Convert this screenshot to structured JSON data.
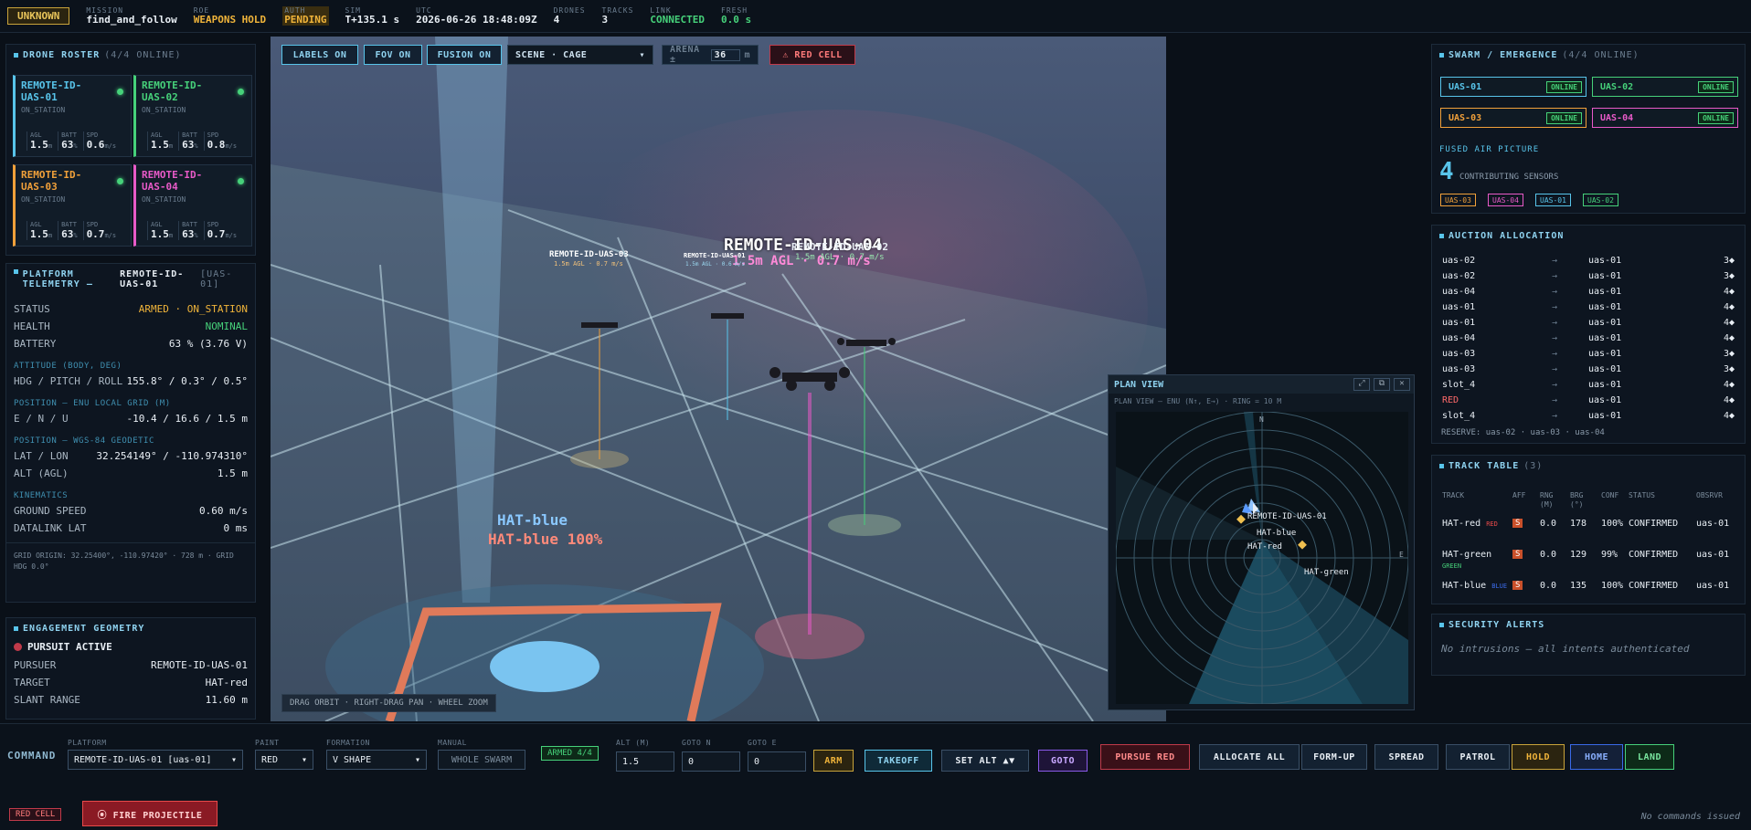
{
  "topbar": {
    "status": "UNKNOWN",
    "items": [
      {
        "k": "MISSION",
        "v": "find_and_follow"
      },
      {
        "k": "ROE",
        "v": "WEAPONS HOLD"
      },
      {
        "k": "AUTH",
        "v": "PENDING"
      },
      {
        "k": "SIM",
        "v": "T+135.1 s"
      },
      {
        "k": "UTC",
        "v": "2026-06-26 18:48:09Z"
      },
      {
        "k": "DRONES",
        "v": "4"
      },
      {
        "k": "TRACKS",
        "v": "3"
      },
      {
        "k": "LINK",
        "v": "CONNECTED"
      },
      {
        "k": "FRESH",
        "v": "0.0 s"
      }
    ]
  },
  "roster": {
    "title": "DRONE ROSTER",
    "sub": "(4/4 ONLINE)",
    "drones": [
      {
        "name": "REMOTE-ID-UAS-01",
        "state": "ON_STATION",
        "agl": "1.5",
        "batt": "63",
        "spd": "0.6",
        "color": "#58c4ea"
      },
      {
        "name": "REMOTE-ID-UAS-02",
        "state": "ON_STATION",
        "agl": "1.5",
        "batt": "63",
        "spd": "0.8",
        "color": "#46d17a"
      },
      {
        "name": "REMOTE-ID-UAS-03",
        "state": "ON_STATION",
        "agl": "1.5",
        "batt": "63",
        "spd": "0.7",
        "color": "#f0a03a"
      },
      {
        "name": "REMOTE-ID-UAS-04",
        "state": "ON_STATION",
        "agl": "1.5",
        "batt": "63",
        "spd": "0.7",
        "color": "#e85ac8"
      }
    ],
    "labels": {
      "agl": "AGL",
      "batt": "BATT",
      "spd": "SPD",
      "m": "m",
      "pct": "%",
      "ms": "m/s"
    }
  },
  "telemetry": {
    "title": "PLATFORM TELEMETRY —",
    "platform": "REMOTE-ID-UAS-01",
    "platform_id": "[UAS-01]",
    "status_k": "STATUS",
    "status_v": "ARMED · ON_STATION",
    "health_k": "HEALTH",
    "health_v": "NOMINAL",
    "battery_k": "BATTERY",
    "battery_v": "63 % (3.76 V)",
    "att_sec": "ATTITUDE (BODY, DEG)",
    "att_k": "HDG / PITCH / ROLL",
    "att_v": "155.8° / 0.3° / 0.5°",
    "pos_sec": "POSITION — ENU LOCAL GRID (M)",
    "enu_k": "E / N / U",
    "enu_v": "-10.4 / 16.6 / 1.5 m",
    "wgs_sec": "POSITION — WGS-84 GEODETIC",
    "ll_k": "LAT / LON",
    "ll_v": "32.254149° / -110.974310°",
    "alt_k": "ALT (AGL)",
    "alt_v": "1.5 m",
    "kin_sec": "KINEMATICS",
    "gs_k": "GROUND SPEED",
    "gs_v": "0.60 m/s",
    "dl_k": "DATALINK LAT",
    "dl_v": "0 ms",
    "grid": "GRID ORIGIN: 32.25400°, -110.97420° · 728 m · GRID HDG 0.0°"
  },
  "engagement": {
    "title": "ENGAGEMENT GEOMETRY",
    "state": "PURSUIT ACTIVE",
    "pursuer_k": "PURSUER",
    "pursuer_v": "REMOTE-ID-UAS-01",
    "target_k": "TARGET",
    "target_v": "HAT-red",
    "slant_k": "SLANT RANGE",
    "slant_v": "11.60 m"
  },
  "toolbar": {
    "labels": "LABELS ON",
    "fov": "FOV ON",
    "fusion": "FUSION ON",
    "scene": "SCENE · CAGE",
    "arena_k": "ARENA ±",
    "arena_v": "36",
    "arena_u": "m",
    "redcell": "⚠ RED CELL"
  },
  "scene": {
    "main_label": "REMOTE-ID-UAS-04",
    "main_sub": "1.5m AGL · 0.7 m/s",
    "uas02": "REMOTE-ID-UAS-02",
    "uas02_sub": "1.5m AGL · 0.7 m/s",
    "uas03": "REMOTE-ID-UAS-03",
    "uas03_sub": "1.5m AGL · 0.7 m/s",
    "uas01": "REMOTE-ID-UAS-01",
    "uas01_sub": "1.5m AGL · 0.6 m/s",
    "hat_blue": "HAT-blue",
    "hat_blue_conf": "HAT-blue 100%",
    "hint": "DRAG ORBIT · RIGHT-DRAG PAN · WHEEL ZOOM"
  },
  "plan": {
    "title": "PLAN VIEW",
    "sub": "PLAN VIEW — ENU (N↑, E→) · RING = 10 M",
    "n": "N",
    "e": "E",
    "lbl_uas": "REMOTE-ID-UAS-01",
    "lbl_hatblue": "HAT-blue",
    "lbl_hatred": "HAT-red",
    "lbl_hatgreen": "HAT-green"
  },
  "swarm": {
    "title": "SWARM / EMERGENCE",
    "sub": "(4/4 ONLINE)",
    "units": [
      {
        "name": "UAS-01",
        "status": "ONLINE",
        "color": "#58c4ea"
      },
      {
        "name": "UAS-02",
        "status": "ONLINE",
        "color": "#46d17a"
      },
      {
        "name": "UAS-03",
        "status": "ONLINE",
        "color": "#f0a03a"
      },
      {
        "name": "UAS-04",
        "status": "ONLINE",
        "color": "#e85ac8"
      }
    ],
    "fused_title": "FUSED AIR PICTURE",
    "count": "4",
    "count_label": "CONTRIBUTING SENSORS",
    "chips": [
      {
        "name": "UAS-03",
        "color": "#f0a03a"
      },
      {
        "name": "UAS-04",
        "color": "#e85ac8"
      },
      {
        "name": "UAS-01",
        "color": "#58c4ea"
      },
      {
        "name": "UAS-02",
        "color": "#46d17a"
      }
    ]
  },
  "auction": {
    "title": "AUCTION ALLOCATION",
    "rows": [
      {
        "a": "uas-02",
        "b": "uas-01",
        "c": "3◆"
      },
      {
        "a": "uas-02",
        "b": "uas-01",
        "c": "3◆"
      },
      {
        "a": "uas-04",
        "b": "uas-01",
        "c": "4◆"
      },
      {
        "a": "uas-01",
        "b": "uas-01",
        "c": "4◆"
      },
      {
        "a": "uas-01",
        "b": "uas-01",
        "c": "4◆"
      },
      {
        "a": "uas-04",
        "b": "uas-01",
        "c": "4◆"
      },
      {
        "a": "uas-03",
        "b": "uas-01",
        "c": "3◆"
      },
      {
        "a": "uas-03",
        "b": "uas-01",
        "c": "3◆"
      },
      {
        "a": "slot_4",
        "b": "uas-01",
        "c": "4◆"
      },
      {
        "a": "RED",
        "b": "uas-01",
        "c": "4◆"
      },
      {
        "a": "slot_4",
        "b": "uas-01",
        "c": "4◆"
      }
    ],
    "arrow": "→",
    "reserve": "RESERVE: uas-02 · uas-03 · uas-04"
  },
  "tracks": {
    "title": "TRACK TABLE",
    "sub": "(3)",
    "headers": [
      "TRACK",
      "AFF",
      "RNG (M)",
      "BRG (°)",
      "CONF",
      "STATUS",
      "OBSRVR"
    ],
    "rows": [
      {
        "track": "HAT-red",
        "tag": "RED",
        "tagcolor": "#e84a4a",
        "aff": "S",
        "rng": "0.0",
        "brg": "178",
        "conf": "100%",
        "status": "CONFIRMED",
        "obs": "uas-01"
      },
      {
        "track": "HAT-green",
        "tag": "GREEN",
        "tagcolor": "#46d17a",
        "aff": "S",
        "rng": "0.0",
        "brg": "129",
        "conf": "99%",
        "status": "CONFIRMED",
        "obs": "uas-01"
      },
      {
        "track": "HAT-blue",
        "tag": "BLUE",
        "tagcolor": "#3a6ae8",
        "aff": "S",
        "rng": "0.0",
        "brg": "135",
        "conf": "100%",
        "status": "CONFIRMED",
        "obs": "uas-01"
      }
    ]
  },
  "alerts": {
    "title": "SECURITY ALERTS",
    "msg": "No intrusions — all intents authenticated"
  },
  "command": {
    "label": "COMMAND",
    "platform_k": "PLATFORM",
    "platform_v": "REMOTE-ID-UAS-01 [uas-01]",
    "paint_k": "PAINT",
    "paint_v": "RED",
    "formation_k": "FORMATION",
    "formation_v": "V SHAPE",
    "manual_k": "MANUAL",
    "manual_v": "WHOLE SWARM",
    "armed": "ARMED 4/4",
    "alt_k": "ALT (M)",
    "alt_v": "1.5",
    "goton_k": "GOTO N",
    "goton_v": "0",
    "gotoe_k": "GOTO E",
    "gotoe_v": "0",
    "arm": "ARM",
    "takeoff": "TAKEOFF",
    "setalt": "SET ALT ▲▼",
    "goto": "GOTO",
    "pursue": "PURSUE RED",
    "allocate": "ALLOCATE ALL",
    "formup": "FORM-UP",
    "spread": "SPREAD",
    "patrol": "PATROL",
    "hold": "HOLD",
    "home": "HOME",
    "land": "LAND",
    "redcell": "RED CELL",
    "fire": "⦿ FIRE PROJECTILE",
    "log": "No commands issued"
  }
}
